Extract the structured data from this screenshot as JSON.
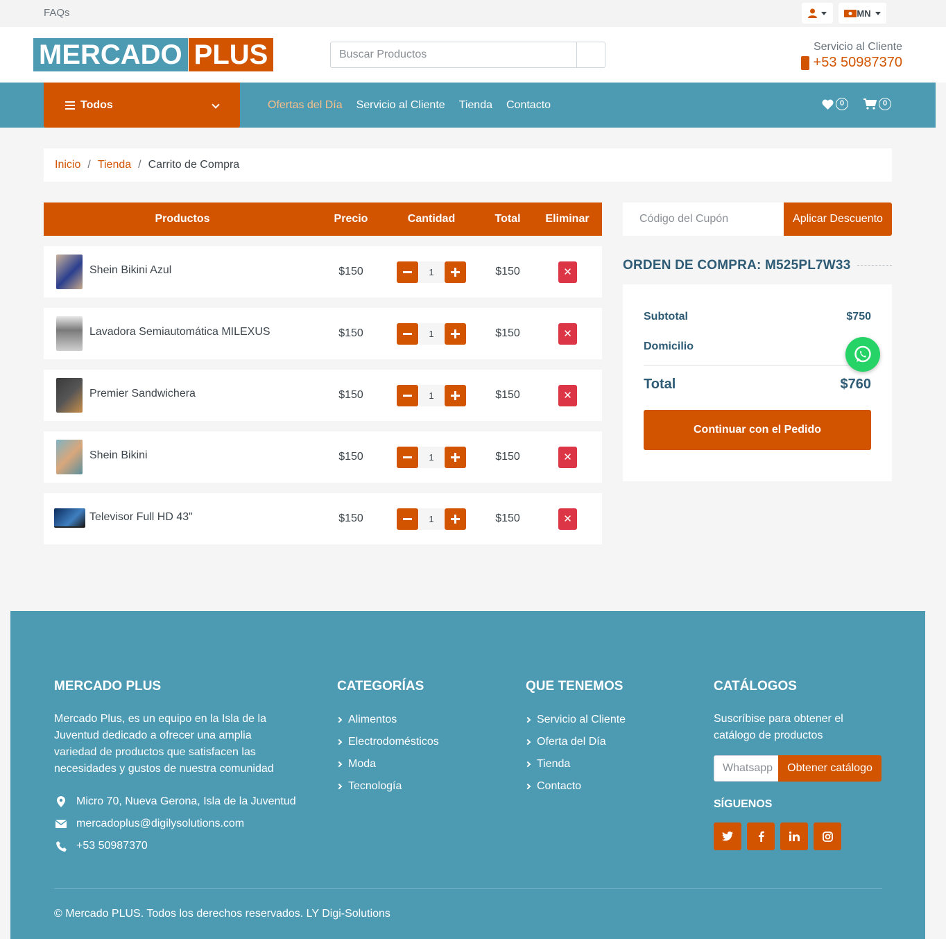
{
  "topbar": {
    "faqs": "FAQs",
    "currency": "MN"
  },
  "header": {
    "logo_part1": "MERCADO",
    "logo_part2": "PLUS",
    "search_placeholder": "Buscar Productos",
    "service_label": "Servicio al Cliente",
    "service_phone": "+53 50987370"
  },
  "nav": {
    "all_label": "Todos",
    "links": [
      "Ofertas del Día",
      "Servicio al Cliente",
      "Tienda",
      "Contacto"
    ],
    "wishlist_count": "0",
    "cart_count": "0"
  },
  "breadcrumb": {
    "home": "Inicio",
    "shop": "Tienda",
    "current": "Carrito de Compra"
  },
  "cart": {
    "headers": {
      "products": "Productos",
      "price": "Precio",
      "quantity": "Cantidad",
      "total": "Total",
      "remove": "Eliminar"
    },
    "items": [
      {
        "name": "Shein Bikini Azul",
        "price": "$150",
        "qty": "1",
        "total": "$150"
      },
      {
        "name": "Lavadora Semiautomática MILEXUS",
        "price": "$150",
        "qty": "1",
        "total": "$150"
      },
      {
        "name": "Premier Sandwichera",
        "price": "$150",
        "qty": "1",
        "total": "$150"
      },
      {
        "name": "Shein Bikini",
        "price": "$150",
        "qty": "1",
        "total": "$150"
      },
      {
        "name": "Televisor Full HD 43\"",
        "price": "$150",
        "qty": "1",
        "total": "$150"
      }
    ],
    "remove_symbol": "✕"
  },
  "coupon": {
    "placeholder": "Código del Cupón",
    "apply_label": "Aplicar Descuento"
  },
  "order": {
    "title": "ORDEN DE COMPRA: M525PL7W33",
    "subtotal_label": "Subtotal",
    "subtotal_value": "$750",
    "delivery_label": "Domicilio",
    "total_label": "Total",
    "total_value": "$760",
    "continue_label": "Continuar con el Pedido"
  },
  "footer": {
    "about_title": "MERCADO PLUS",
    "about_text": "Mercado Plus, es un equipo en la Isla de la Juventud dedicado a ofrecer una amplia variedad de productos que satisfacen las necesidades y gustos de nuestra comunidad",
    "address": "Micro 70, Nueva Gerona, Isla de la Juventud",
    "email": "mercadoplus@digilysolutions.com",
    "phone": "+53 50987370",
    "categories_title": "CATEGORÍAS",
    "categories": [
      "Alimentos",
      "Electrodomésticos",
      "Moda",
      "Tecnología"
    ],
    "have_title": "QUE TENEMOS",
    "have": [
      "Servicio al Cliente",
      "Oferta del Día",
      "Tienda",
      "Contacto"
    ],
    "catalogs_title": "CATÁLOGOS",
    "catalogs_text": "Suscríbise para obtener el catálogo de productos",
    "whatsapp_placeholder": "Whatsapp",
    "get_catalog_label": "Obtener catálogo",
    "follow_title": "SÍGUENOS",
    "copyright": "© Mercado PLUS. Todos los derechos reservados. LY Digi-Solutions"
  },
  "colors": {
    "brand_orange": "#d35400",
    "brand_teal": "#4d9ab3",
    "danger": "#dc3545",
    "whatsapp": "#25d366"
  }
}
